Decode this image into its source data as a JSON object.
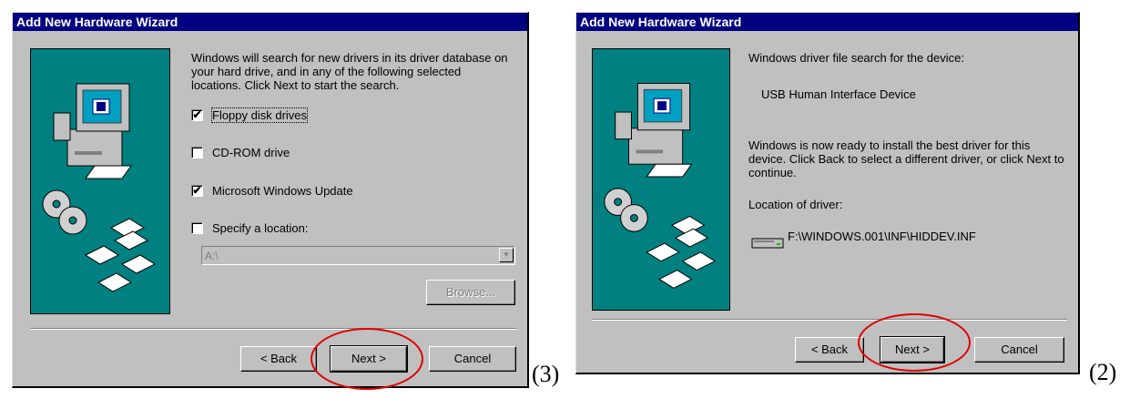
{
  "dialog1": {
    "title": "Add New Hardware Wizard",
    "intro": "Windows will search for new drivers in its driver database on your hard drive, and in any of the following selected locations. Click Next to start the search.",
    "options": [
      {
        "label": "Floppy disk drives",
        "checked": true
      },
      {
        "label": "CD-ROM drive",
        "checked": false
      },
      {
        "label": "Microsoft Windows Update",
        "checked": true
      },
      {
        "label": "Specify a location:",
        "checked": false
      }
    ],
    "location_value": "A:\\",
    "browse_label": "Browse...",
    "back_label": "< Back",
    "next_label": "Next >",
    "cancel_label": "Cancel",
    "step_label": "(3)"
  },
  "dialog2": {
    "title": "Add New Hardware Wizard",
    "search_text": "Windows driver file search for the device:",
    "device_name": "USB Human Interface Device",
    "ready_text": "Windows is now ready to install the best driver for this device. Click Back to select a different driver, or click Next to continue.",
    "location_label": "Location of driver:",
    "driver_path": "F:\\WINDOWS.001\\INF\\HIDDEV.INF",
    "back_label": "< Back",
    "next_label": "Next >",
    "cancel_label": "Cancel",
    "step_label": "(2)"
  },
  "colors": {
    "titlebar": "#000080",
    "dialog_bg": "#c0c0c0",
    "wizard_image_bg": "#008080",
    "highlight": "#e00000"
  },
  "icons": [
    "computer-icon",
    "cd-disc-icon",
    "floppy-disk-icon",
    "drive-icon",
    "checkmark-icon",
    "dropdown-arrow-icon"
  ]
}
